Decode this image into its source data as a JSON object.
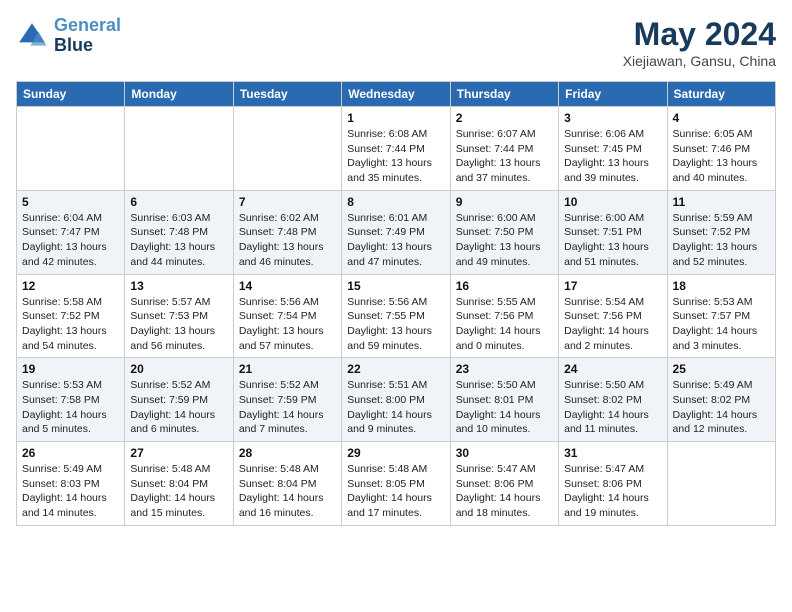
{
  "logo": {
    "line1": "General",
    "line2": "Blue"
  },
  "title": "May 2024",
  "subtitle": "Xiejiawan, Gansu, China",
  "weekdays": [
    "Sunday",
    "Monday",
    "Tuesday",
    "Wednesday",
    "Thursday",
    "Friday",
    "Saturday"
  ],
  "weeks": [
    [
      {
        "day": "",
        "info": ""
      },
      {
        "day": "",
        "info": ""
      },
      {
        "day": "",
        "info": ""
      },
      {
        "day": "1",
        "info": "Sunrise: 6:08 AM\nSunset: 7:44 PM\nDaylight: 13 hours\nand 35 minutes."
      },
      {
        "day": "2",
        "info": "Sunrise: 6:07 AM\nSunset: 7:44 PM\nDaylight: 13 hours\nand 37 minutes."
      },
      {
        "day": "3",
        "info": "Sunrise: 6:06 AM\nSunset: 7:45 PM\nDaylight: 13 hours\nand 39 minutes."
      },
      {
        "day": "4",
        "info": "Sunrise: 6:05 AM\nSunset: 7:46 PM\nDaylight: 13 hours\nand 40 minutes."
      }
    ],
    [
      {
        "day": "5",
        "info": "Sunrise: 6:04 AM\nSunset: 7:47 PM\nDaylight: 13 hours\nand 42 minutes."
      },
      {
        "day": "6",
        "info": "Sunrise: 6:03 AM\nSunset: 7:48 PM\nDaylight: 13 hours\nand 44 minutes."
      },
      {
        "day": "7",
        "info": "Sunrise: 6:02 AM\nSunset: 7:48 PM\nDaylight: 13 hours\nand 46 minutes."
      },
      {
        "day": "8",
        "info": "Sunrise: 6:01 AM\nSunset: 7:49 PM\nDaylight: 13 hours\nand 47 minutes."
      },
      {
        "day": "9",
        "info": "Sunrise: 6:00 AM\nSunset: 7:50 PM\nDaylight: 13 hours\nand 49 minutes."
      },
      {
        "day": "10",
        "info": "Sunrise: 6:00 AM\nSunset: 7:51 PM\nDaylight: 13 hours\nand 51 minutes."
      },
      {
        "day": "11",
        "info": "Sunrise: 5:59 AM\nSunset: 7:52 PM\nDaylight: 13 hours\nand 52 minutes."
      }
    ],
    [
      {
        "day": "12",
        "info": "Sunrise: 5:58 AM\nSunset: 7:52 PM\nDaylight: 13 hours\nand 54 minutes."
      },
      {
        "day": "13",
        "info": "Sunrise: 5:57 AM\nSunset: 7:53 PM\nDaylight: 13 hours\nand 56 minutes."
      },
      {
        "day": "14",
        "info": "Sunrise: 5:56 AM\nSunset: 7:54 PM\nDaylight: 13 hours\nand 57 minutes."
      },
      {
        "day": "15",
        "info": "Sunrise: 5:56 AM\nSunset: 7:55 PM\nDaylight: 13 hours\nand 59 minutes."
      },
      {
        "day": "16",
        "info": "Sunrise: 5:55 AM\nSunset: 7:56 PM\nDaylight: 14 hours\nand 0 minutes."
      },
      {
        "day": "17",
        "info": "Sunrise: 5:54 AM\nSunset: 7:56 PM\nDaylight: 14 hours\nand 2 minutes."
      },
      {
        "day": "18",
        "info": "Sunrise: 5:53 AM\nSunset: 7:57 PM\nDaylight: 14 hours\nand 3 minutes."
      }
    ],
    [
      {
        "day": "19",
        "info": "Sunrise: 5:53 AM\nSunset: 7:58 PM\nDaylight: 14 hours\nand 5 minutes."
      },
      {
        "day": "20",
        "info": "Sunrise: 5:52 AM\nSunset: 7:59 PM\nDaylight: 14 hours\nand 6 minutes."
      },
      {
        "day": "21",
        "info": "Sunrise: 5:52 AM\nSunset: 7:59 PM\nDaylight: 14 hours\nand 7 minutes."
      },
      {
        "day": "22",
        "info": "Sunrise: 5:51 AM\nSunset: 8:00 PM\nDaylight: 14 hours\nand 9 minutes."
      },
      {
        "day": "23",
        "info": "Sunrise: 5:50 AM\nSunset: 8:01 PM\nDaylight: 14 hours\nand 10 minutes."
      },
      {
        "day": "24",
        "info": "Sunrise: 5:50 AM\nSunset: 8:02 PM\nDaylight: 14 hours\nand 11 minutes."
      },
      {
        "day": "25",
        "info": "Sunrise: 5:49 AM\nSunset: 8:02 PM\nDaylight: 14 hours\nand 12 minutes."
      }
    ],
    [
      {
        "day": "26",
        "info": "Sunrise: 5:49 AM\nSunset: 8:03 PM\nDaylight: 14 hours\nand 14 minutes."
      },
      {
        "day": "27",
        "info": "Sunrise: 5:48 AM\nSunset: 8:04 PM\nDaylight: 14 hours\nand 15 minutes."
      },
      {
        "day": "28",
        "info": "Sunrise: 5:48 AM\nSunset: 8:04 PM\nDaylight: 14 hours\nand 16 minutes."
      },
      {
        "day": "29",
        "info": "Sunrise: 5:48 AM\nSunset: 8:05 PM\nDaylight: 14 hours\nand 17 minutes."
      },
      {
        "day": "30",
        "info": "Sunrise: 5:47 AM\nSunset: 8:06 PM\nDaylight: 14 hours\nand 18 minutes."
      },
      {
        "day": "31",
        "info": "Sunrise: 5:47 AM\nSunset: 8:06 PM\nDaylight: 14 hours\nand 19 minutes."
      },
      {
        "day": "",
        "info": ""
      }
    ]
  ]
}
